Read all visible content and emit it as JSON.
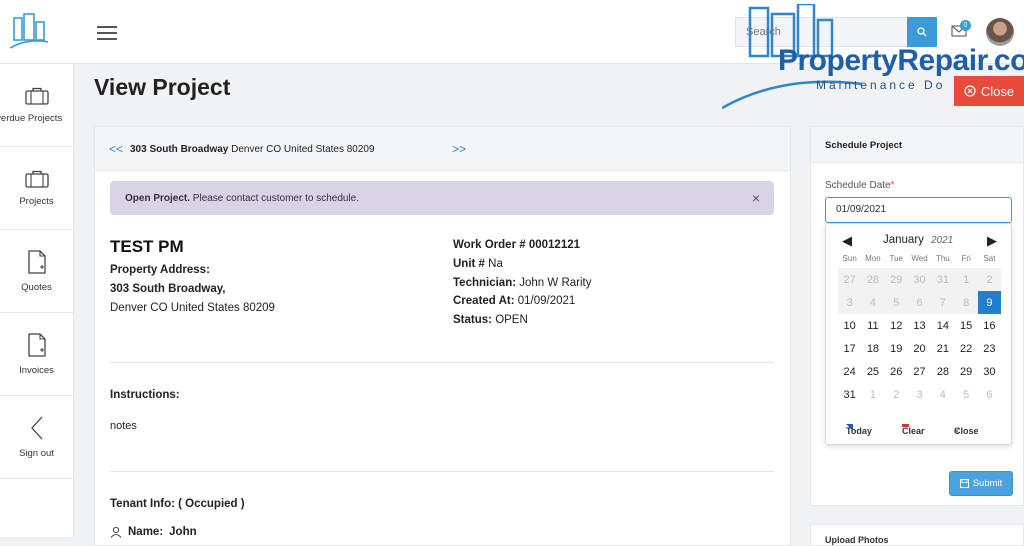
{
  "header": {
    "search_placeholder": "Search",
    "mail_count": "0"
  },
  "watermark": {
    "title": "PropertyRepair.co",
    "subtitle": "Maintenance Do"
  },
  "close_button": "Close",
  "sidebar": {
    "items": [
      {
        "label": "Overdue Projects",
        "icon": "briefcase-icon"
      },
      {
        "label": "Projects",
        "icon": "briefcase-icon"
      },
      {
        "label": "Quotes",
        "icon": "document-plus-icon"
      },
      {
        "label": "Invoices",
        "icon": "document-plus-icon"
      },
      {
        "label": "Sign out",
        "icon": "arrow-left-icon"
      }
    ]
  },
  "page": {
    "title": "View Project"
  },
  "project": {
    "nav_prev": "<<",
    "nav_next": ">>",
    "address_street": "303 South Broadway",
    "address_rest": "Denver CO United States 80209",
    "alert_strong": "Open Project.",
    "alert_text": "Please contact customer to schedule.",
    "alert_close": "×",
    "title": "TEST PM",
    "property_label": "Property Address:",
    "property_line1": "303 South Broadway,",
    "property_line2": "Denver CO United States 80209",
    "work_order_label": "Work Order # 00012121",
    "unit_label": "Unit #",
    "unit_value": "Na",
    "technician_label": "Technician:",
    "technician_value": "John W Rarity",
    "created_label": "Created At:",
    "created_value": "01/09/2021",
    "status_label": "Status:",
    "status_value": "OPEN",
    "instructions_label": "Instructions:",
    "notes": "notes",
    "tenant_label": "Tenant Info: ( Occupied )",
    "tenant_name_label": "Name:",
    "tenant_name_value": "John"
  },
  "schedule": {
    "title": "Schedule Project",
    "date_label": "Schedule Date",
    "required_mark": "*",
    "date_value": "01/09/2021",
    "submit_label": "Submit"
  },
  "calendar": {
    "month": "January",
    "year": "2021",
    "prev": "◀",
    "next": "▶",
    "days_of_week": [
      "Sun",
      "Mon",
      "Tue",
      "Wed",
      "Thu",
      "Fri",
      "Sat"
    ],
    "weeks": [
      [
        "27",
        "28",
        "29",
        "30",
        "31",
        "1",
        "2"
      ],
      [
        "3",
        "4",
        "5",
        "6",
        "7",
        "8",
        "9"
      ],
      [
        "10",
        "11",
        "12",
        "13",
        "14",
        "15",
        "16"
      ],
      [
        "17",
        "18",
        "19",
        "20",
        "21",
        "22",
        "23"
      ],
      [
        "24",
        "25",
        "26",
        "27",
        "28",
        "29",
        "30"
      ],
      [
        "31",
        "1",
        "2",
        "3",
        "4",
        "5",
        "6"
      ]
    ],
    "selected": "9",
    "today_label": "Today",
    "clear_label": "Clear",
    "close_label": "Close"
  },
  "upload": {
    "title": "Upload Photos"
  }
}
